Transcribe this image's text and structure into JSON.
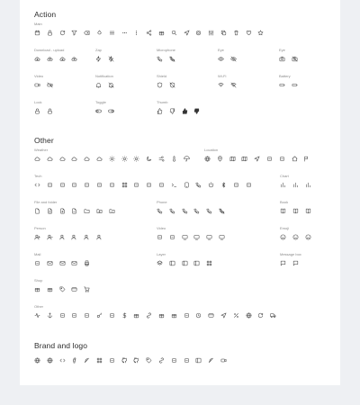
{
  "sections": [
    {
      "title": "Action",
      "groups": [
        {
          "label": "Main",
          "icons": [
            "calendar-icon",
            "clock-icon",
            "refresh-icon",
            "filter-icon",
            "backspace-icon",
            "droplet-icon",
            "menu-icon",
            "more-horizontal-icon",
            "more-vertical-icon",
            "share-icon",
            "upload-box-icon",
            "search-icon",
            "send-icon",
            "settings-icon",
            "sliders-icon",
            "copy-icon",
            "trash-icon",
            "heart-icon",
            "star-icon"
          ]
        },
        {
          "label": "Download - upload",
          "icons": [
            "cloud-download-icon",
            "cloud-upload-icon",
            "download-icon",
            "upload-icon"
          ]
        },
        {
          "label": "Zap",
          "icons": [
            "zap-icon",
            "zap-off-icon"
          ]
        },
        {
          "label": "Microphone",
          "icons": [
            "microphone-icon",
            "microphone-off-icon"
          ]
        },
        {
          "label": "Eye",
          "icons": [
            "eye-icon",
            "eye-off-icon"
          ]
        },
        {
          "label": "Eye",
          "icons": [
            "camera-icon",
            "camera-off-icon"
          ]
        },
        {
          "label": "Video",
          "icons": [
            "video-icon",
            "video-off-icon"
          ]
        },
        {
          "label": "Notification",
          "icons": [
            "bell-icon",
            "bell-off-icon"
          ]
        },
        {
          "label": "Shield",
          "icons": [
            "shield-icon",
            "shield-off-icon"
          ]
        },
        {
          "label": "Wi-Fi",
          "icons": [
            "wifi-icon",
            "wifi-off-icon"
          ]
        },
        {
          "label": "Battery",
          "icons": [
            "battery-icon",
            "battery-charging-icon"
          ]
        },
        {
          "label": "Lock",
          "icons": [
            "lock-icon",
            "unlock-icon"
          ]
        },
        {
          "label": "Toggle",
          "icons": [
            "toggle-left-icon",
            "toggle-right-icon"
          ]
        },
        {
          "label": "Thumb",
          "icons": [
            "thumbs-up-icon",
            "thumbs-down-icon",
            "thumbs-up-filled-icon",
            "thumbs-down-filled-icon"
          ]
        }
      ]
    },
    {
      "title": "Other",
      "groups": [
        {
          "label": "Weather",
          "icons": [
            "cloud-icon",
            "cloud-drizzle-icon",
            "cloud-snow-icon",
            "cloud-rain-icon",
            "cloud-hail-icon",
            "cloud-lightning-icon",
            "sun-icon",
            "sunrise-icon",
            "sunset-icon",
            "moon-icon",
            "wind-icon",
            "thermometer-icon",
            "umbrella-icon"
          ]
        },
        {
          "label": "Location",
          "icons": [
            "globe-icon",
            "map-pin-icon",
            "map-icon",
            "map-alt-icon",
            "navigation-icon",
            "compass-icon",
            "target-icon",
            "home-icon",
            "flag-icon"
          ]
        },
        {
          "label": "Tech",
          "icons": [
            "code-icon",
            "git-branch-icon",
            "command-icon",
            "hash-icon",
            "git-commit-icon",
            "git-pull-request-icon",
            "arrows-switch-icon",
            "grid-hash-icon",
            "hard-drive-icon",
            "server-icon",
            "database-icon",
            "terminal-icon",
            "tablet-icon",
            "smartphone-icon",
            "power-icon",
            "bluetooth-icon",
            "radio-icon",
            "mouse-icon"
          ]
        },
        {
          "label": "Chart",
          "icons": [
            "bar-chart-icon",
            "bar-chart-alt-icon",
            "pie-chart-icon"
          ]
        },
        {
          "label": "File and folder",
          "icons": [
            "file-icon",
            "file-text-icon",
            "file-plus-icon",
            "file-minus-icon",
            "folder-icon",
            "folder-plus-icon",
            "folder-minus-icon"
          ]
        },
        {
          "label": "Phone",
          "icons": [
            "phone-icon",
            "phone-call-icon",
            "phone-incoming-icon",
            "phone-outgoing-icon",
            "phone-forwarded-icon",
            "phone-off-icon"
          ]
        },
        {
          "label": "Book",
          "icons": [
            "book-icon",
            "bookmark-icon",
            "book-open-icon"
          ]
        },
        {
          "label": "Person",
          "icons": [
            "user-plus-icon",
            "user-minus-icon",
            "user-check-icon",
            "user-x-icon",
            "user-icon",
            "users-icon"
          ]
        },
        {
          "label": "Video",
          "icons": [
            "film-icon",
            "film-alt-icon",
            "monitor-icon",
            "cast-icon",
            "tv-icon",
            "tv-alt-icon"
          ]
        },
        {
          "label": "Emoji",
          "icons": [
            "smile-icon",
            "meh-icon",
            "frown-icon"
          ]
        },
        {
          "label": "Mail",
          "icons": [
            "at-sign-icon",
            "mail-icon",
            "inbox-icon",
            "archive-icon",
            "printer-icon"
          ]
        },
        {
          "label": "Layer",
          "icons": [
            "layers-icon",
            "sidebar-icon",
            "columns-icon",
            "panel-icon",
            "grid-icon"
          ]
        },
        {
          "label": "Message box",
          "icons": [
            "message-square-icon",
            "message-circle-icon"
          ]
        },
        {
          "label": "Shop",
          "icons": [
            "package-icon",
            "shopping-bag-icon",
            "tag-icon",
            "credit-card-icon",
            "shopping-cart-icon"
          ]
        },
        {
          "label": "Other",
          "icons": [
            "activity-icon",
            "anchor-icon",
            "tool-icon",
            "award-icon",
            "life-buoy-icon",
            "key-icon",
            "at-circle-icon",
            "dollar-sign-icon",
            "gift-icon",
            "link-icon",
            "box-icon",
            "cube-icon",
            "coffee-icon",
            "watch-icon",
            "id-card-icon",
            "cursor-icon",
            "percent-icon",
            "aperture-icon",
            "loader-icon",
            "truck-icon"
          ]
        }
      ]
    },
    {
      "title": "Brand and logo",
      "groups": [
        {
          "label": "",
          "icons": [
            "chrome-icon",
            "dribbble-icon",
            "codepen-icon",
            "facebook-icon",
            "feather-icon",
            "figma-icon",
            "framer-icon",
            "github-icon",
            "gitlab-icon",
            "instagram-icon",
            "linkedin-icon",
            "pocket-icon",
            "slack-icon",
            "trello-icon",
            "twitter-icon",
            "youtube-icon"
          ]
        }
      ]
    }
  ]
}
